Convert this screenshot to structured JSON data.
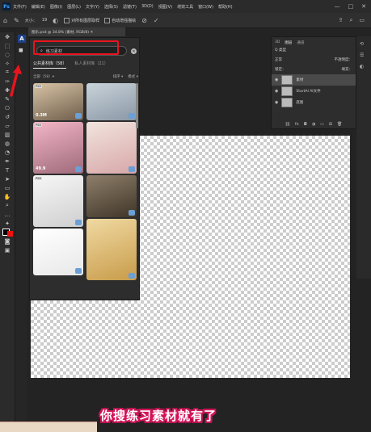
{
  "menu": {
    "logo": "Ps",
    "items": [
      "文件(F)",
      "编辑(E)",
      "图像(I)",
      "图层(L)",
      "文字(Y)",
      "选择(S)",
      "滤镜(T)",
      "3D(D)",
      "视图(V)",
      "增效工具",
      "窗口(W)",
      "帮助(H)"
    ],
    "window_controls": [
      "—",
      "□",
      "✕"
    ]
  },
  "options_bar": {
    "size_label": "大小：",
    "size_value": "19",
    "option1": "对所有图层取样",
    "option2": "自动增强描绘",
    "right_icons": [
      "share-icon",
      "search-icon",
      "settings-icon"
    ]
  },
  "document_tab": {
    "title": "图乐.psd @ 34.8% (素材, RGB/8) ✕"
  },
  "assets_panel": {
    "search_query": "练习素材",
    "tabs": {
      "public": "公共素材库（58）",
      "private": "私人素材库（21）"
    },
    "filters": {
      "all": "全部（58）▾",
      "sort": "排序 ▾",
      "mode": "模式 ▾"
    },
    "thumbnails": [
      {
        "badge": "PSD",
        "label": "0.3M",
        "colors": [
          "#d8c4a6",
          "#6e5d4b"
        ]
      },
      {
        "badge": "",
        "label": "",
        "colors": [
          "#c9d3da",
          "#8a97a5"
        ]
      },
      {
        "badge": "PSD",
        "label": "49.9",
        "colors": [
          "#f3b6c7",
          "#9e6a7a"
        ]
      },
      {
        "badge": "",
        "label": "",
        "colors": [
          "#f2e4de",
          "#d7a7a8"
        ]
      },
      {
        "badge": "PSD",
        "label": "",
        "colors": [
          "#f7f7f7",
          "#cfcfcf"
        ]
      },
      {
        "badge": "",
        "label": "",
        "colors": [
          "#8e7f6a",
          "#3f3528"
        ]
      },
      {
        "badge": "",
        "label": "",
        "colors": [
          "#ffffff",
          "#e8e8e8"
        ]
      },
      {
        "badge": "",
        "label": "",
        "colors": [
          "#f0d9a2",
          "#c89c4a"
        ]
      }
    ]
  },
  "layers_panel": {
    "tabs": [
      "3D",
      "图层",
      "通道"
    ],
    "filter_label": "Q 类型",
    "blend_mode": "正常",
    "opacity_label": "不透明度：",
    "lock_label": "锁定：",
    "fill_label": "填充：",
    "layers": [
      {
        "name": "素材",
        "selected": true
      },
      {
        "name": "StartAI AI文件",
        "selected": false
      },
      {
        "name": "底图",
        "selected": false
      }
    ]
  },
  "caption": "你搜练习素材就有了",
  "colors": {
    "highlight": "#e8141e",
    "caption_outline": "#d4145a",
    "accent": "#1c3f8a"
  }
}
